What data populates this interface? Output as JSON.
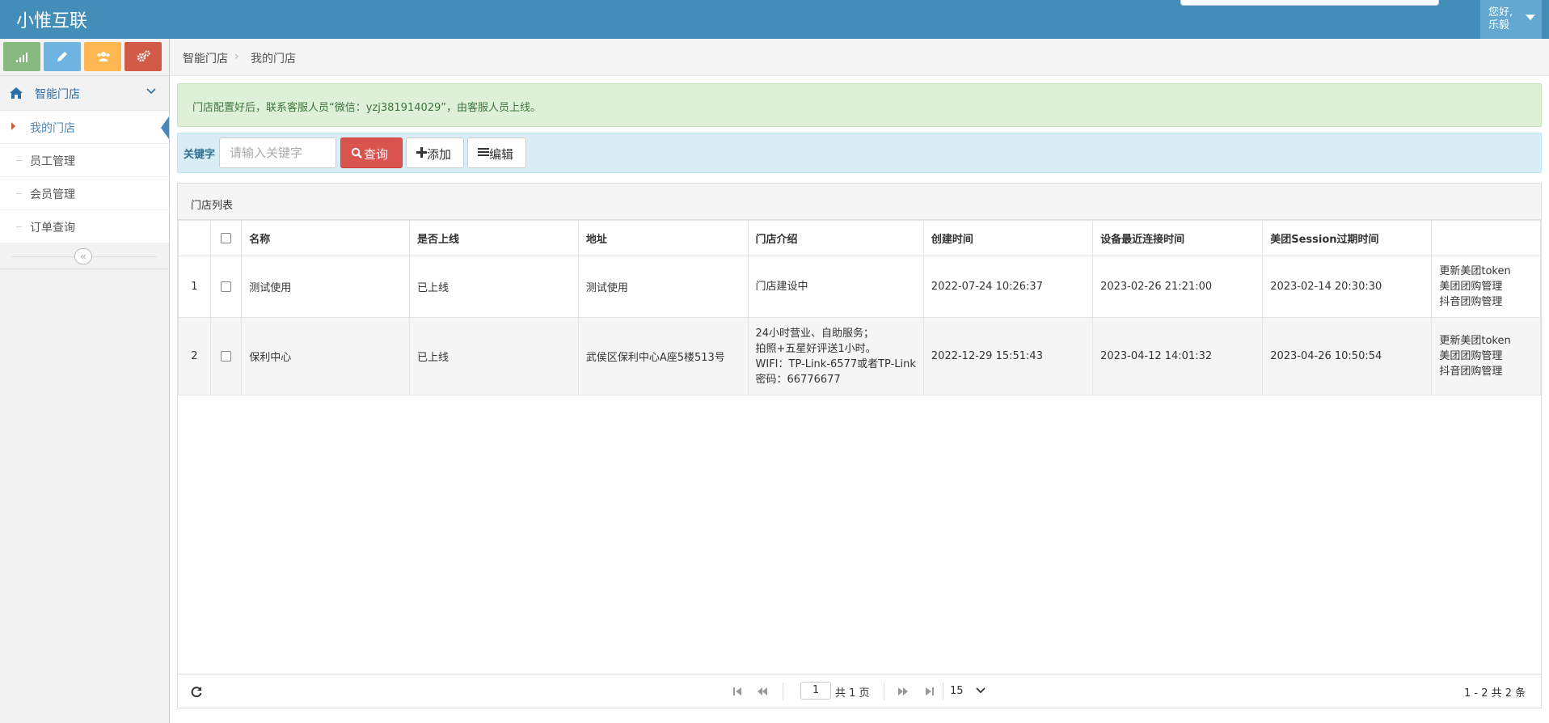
{
  "app": {
    "title": "小惟互联",
    "greeting_line1": "您好,",
    "greeting_line2": "乐毅"
  },
  "shortcut_icons": [
    "signal-icon",
    "pencil-icon",
    "users-icon",
    "cogs-icon"
  ],
  "sidebar": {
    "parent": {
      "label": "智能门店",
      "icon": "home-icon"
    },
    "items": [
      {
        "label": "我的门店",
        "active": true
      },
      {
        "label": "员工管理",
        "active": false
      },
      {
        "label": "会员管理",
        "active": false
      },
      {
        "label": "订单查询",
        "active": false
      }
    ],
    "collapse_glyph": "«"
  },
  "breadcrumb": {
    "items": [
      "智能门店",
      "我的门店"
    ],
    "separator": "›"
  },
  "alert": {
    "text": "门店配置好后，联系客服人员“微信：yzj381914029”，由客服人员上线。"
  },
  "toolbar": {
    "keyword_label": "关键字",
    "search_placeholder": "请输入关键字",
    "query_label": "查询",
    "add_label": "添加",
    "edit_label": "编辑"
  },
  "grid": {
    "title": "门店列表",
    "columns": [
      "名称",
      "是否上线",
      "地址",
      "门店介绍",
      "创建时间",
      "设备最近连接时间",
      "美团Session过期时间",
      ""
    ],
    "rows": [
      {
        "num": "1",
        "name": "测试使用",
        "online": "已上线",
        "address": "测试使用",
        "intro": [
          "门店建设中"
        ],
        "created": "2022-07-24 10:26:37",
        "last_connect": "2023-02-26 21:21:00",
        "session_expire": "2023-02-14 20:30:30",
        "actions": [
          "更新美团token",
          "美团团购管理",
          "抖音团购管理"
        ]
      },
      {
        "num": "2",
        "name": "保利中心",
        "online": "已上线",
        "address": "武侯区保利中心A座5楼513号",
        "intro": [
          "24小时营业、自助服务；",
          "拍照+五星好评送1小时。",
          "WIFI：TP-Link-6577或者TP-Link",
          "密码：66776677"
        ],
        "created": "2022-12-29 15:51:43",
        "last_connect": "2023-04-12 14:01:32",
        "session_expire": "2023-04-26 10:50:54",
        "actions": [
          "更新美团token",
          "美团团购管理",
          "抖音团购管理"
        ]
      }
    ]
  },
  "pager": {
    "current_page": "1",
    "total_pages_text": "共 1 页",
    "page_size": "15",
    "range_text": "1 - 2   共 2 条"
  }
}
